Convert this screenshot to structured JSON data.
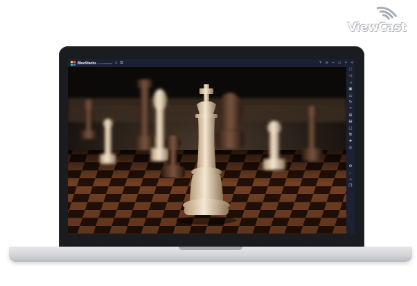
{
  "watermark": {
    "text": "ViewCast"
  },
  "window": {
    "app_name": "BlueStacks",
    "app_version": "5.9.0.1005 Beta",
    "titlebar_left_icons": [
      "home-icon",
      "multi-instance-icon"
    ],
    "titlebar_right_icons": [
      "help-icon",
      "menu-icon",
      "minimize-icon",
      "maximize-icon",
      "close-icon",
      "collapse-sidebar-icon"
    ]
  },
  "screen": {
    "scene": "chess-pieces-on-board",
    "colors": {
      "background": "#0b0a09",
      "board_dark": "#3a1d10",
      "board_light": "#9b5a33",
      "white_piece": "#e9d8bc",
      "dark_piece": "#5a3a28"
    }
  },
  "sidebar": {
    "icons": [
      "fullscreen-icon",
      "volume-up-icon",
      "volume-down-icon",
      "media-icon",
      "screenshot-icon",
      "rotate-icon",
      "shake-icon",
      "gamepad-icon",
      "apk-icon",
      "folder-icon",
      "copy-icon",
      "layers-icon",
      "macro-icon",
      "settings-icon",
      "back-icon",
      "home-icon",
      "recent-apps-icon"
    ]
  }
}
